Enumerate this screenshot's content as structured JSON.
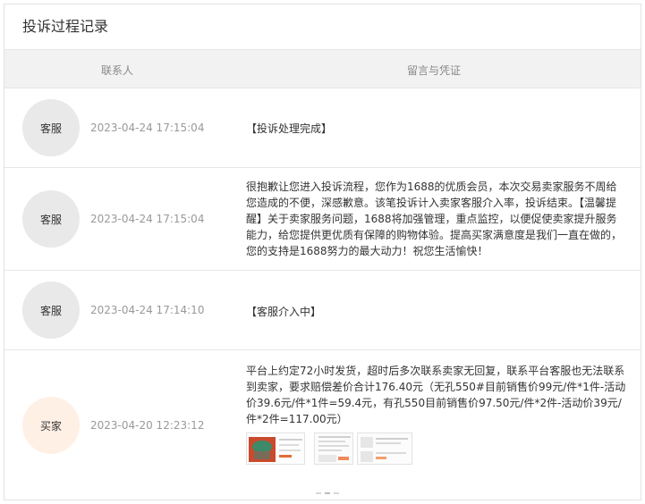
{
  "title": "投诉过程记录",
  "columns": {
    "contact": "联系人",
    "message": "留言与凭证"
  },
  "records": [
    {
      "role": "客服",
      "time": "2023-04-24 17:15:04",
      "message": "【投诉处理完成】"
    },
    {
      "role": "客服",
      "time": "2023-04-24 17:15:04",
      "message": "很抱歉让您进入投诉流程，您作为1688的优质会员，本次交易卖家服务不周给您造成的不便，深感歉意。该笔投诉计入卖家客服介入率，投诉结束。【温馨提醒】关于卖家服务问题，1688将加强管理，重点监控，以便促使卖家提升服务能力，给您提供更优质有保障的购物体验。提高买家满意度是我们一直在做的，您的支持是1688努力的最大动力！祝您生活愉快！"
    },
    {
      "role": "客服",
      "time": "2023-04-24 17:14:10",
      "message": "【客服介入中】"
    },
    {
      "role": "买家",
      "time": "2023-04-20 12:23:12",
      "message": "平台上约定72小时发货，超时后多次联系卖家无回复，联系平台客服也无法联系到卖家，要求赔偿差价合计176.40元（无孔550#目前销售价99元/件*1件-活动价39.6元/件*1件=59.4元，有孔550目前销售价97.50元/件*2件-活动价39元/件*2件=117.00元）"
    }
  ],
  "colors": {
    "buyer_avatar_bg": "#fff0e6",
    "service_avatar_bg": "#e9e9e9",
    "header_bg": "#f2f2f2"
  }
}
